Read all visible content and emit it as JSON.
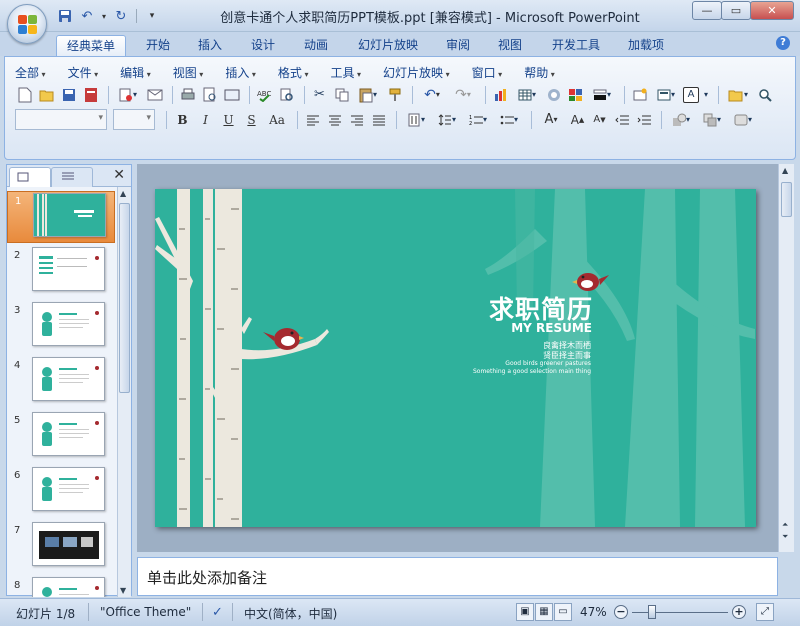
{
  "window": {
    "title": "创意卡通个人求职简历PPT模板.ppt [兼容模式] - Microsoft PowerPoint"
  },
  "ribbon_tabs": [
    {
      "label": "经典菜单",
      "active": true
    },
    {
      "label": "开始"
    },
    {
      "label": "插入"
    },
    {
      "label": "设计"
    },
    {
      "label": "动画"
    },
    {
      "label": "幻灯片放映"
    },
    {
      "label": "审阅"
    },
    {
      "label": "视图"
    },
    {
      "label": "开发工具"
    },
    {
      "label": "加载项"
    }
  ],
  "classic_menu": [
    "全部",
    "文件",
    "编辑",
    "视图",
    "插入",
    "格式",
    "工具",
    "幻灯片放映",
    "窗口",
    "帮助"
  ],
  "format_buttons": [
    "B",
    "I",
    "U",
    "S",
    "Aa"
  ],
  "slide": {
    "title": "求职简历",
    "subtitle": "MY RESUME",
    "line1": "良禽择木而栖",
    "line2": "贤臣择主而事",
    "line3": "Good birds greener pastures",
    "line4": "Something a good selection main thing",
    "bg_color": "#2fb19c",
    "tree_color": "#e9e4da",
    "bird_color": "#a52a2f"
  },
  "thumbnails": [
    "1",
    "2",
    "3",
    "4",
    "5",
    "6",
    "7",
    "8"
  ],
  "notes_placeholder": "单击此处添加备注",
  "status": {
    "slide_info": "幻灯片 1/8",
    "theme": "\"Office Theme\"",
    "language": "中文(简体，中国)",
    "zoom": "47%"
  }
}
